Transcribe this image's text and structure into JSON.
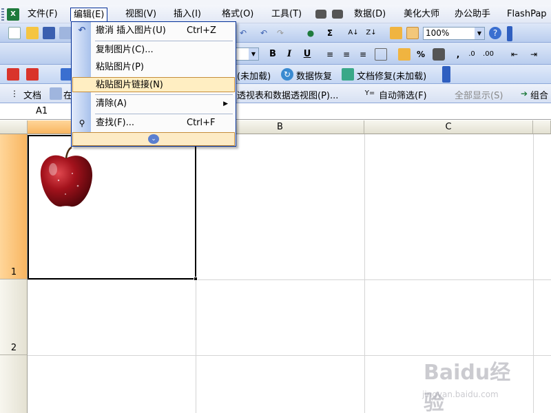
{
  "menubar": {
    "items": [
      "文件(F)",
      "编辑(E)",
      "视图(V)",
      "插入(I)",
      "格式(O)",
      "工具(T)",
      "数据(D)",
      "美化大师",
      "办公助手",
      "FlashPap"
    ]
  },
  "toolbar1": {
    "zoom": "100%",
    "sigma": "Σ"
  },
  "toolbar2": {
    "bold": "B",
    "italic": "I",
    "underline": "U",
    "percent": "%",
    "comma": ","
  },
  "toolbar3": {
    "item_unloaded": "(未加载)",
    "data_recovery": "数据恢复",
    "doc_repair": "文档修复(未加载)"
  },
  "toolbar4": {
    "doc": "文档",
    "doc2": "在",
    "pivot": "透视表和数据透视图(P)...",
    "autofilter": "自动筛选(F)",
    "show_all": "全部显示(S)",
    "group": "组合"
  },
  "namebox": {
    "value": "A1"
  },
  "grid": {
    "columns": [
      "B",
      "C"
    ],
    "rows": [
      "1",
      "2"
    ]
  },
  "edit_menu": {
    "items": [
      {
        "label": "撤消 插入图片(U)",
        "shortcut": "Ctrl+Z"
      },
      {
        "label": "复制图片(C)..."
      },
      {
        "label": "粘贴图片(P)"
      },
      {
        "label": "粘贴图片链接(N)"
      },
      {
        "label": "清除(A)"
      },
      {
        "label": "查找(F)...",
        "shortcut": "Ctrl+F"
      }
    ]
  },
  "watermark": {
    "brand": "Baidu经验",
    "url": "jingyan.baidu.com"
  }
}
